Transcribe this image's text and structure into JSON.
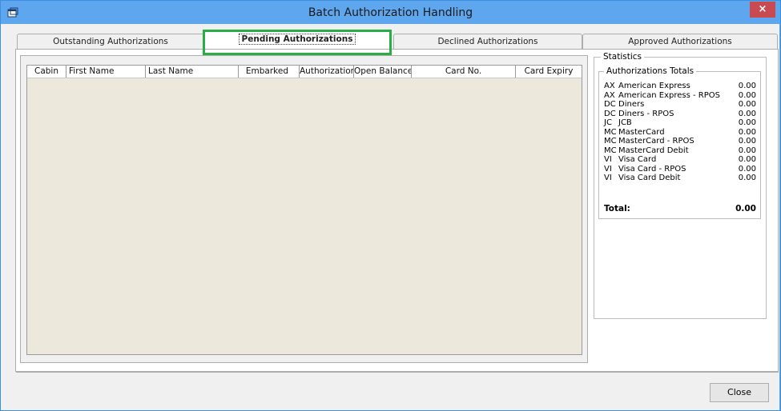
{
  "window": {
    "title": "Batch Authorization Handling",
    "close_glyph": "×"
  },
  "tabs": [
    {
      "label": "Outstanding Authorizations"
    },
    {
      "label": "Pending Authorizations"
    },
    {
      "label": "Declined Authorizations"
    },
    {
      "label": "Approved Authorizations"
    }
  ],
  "grid": {
    "columns": [
      "Cabin",
      "First Name",
      "Last Name",
      "Embarked",
      "Authorization",
      "Open Balance",
      "Card No.",
      "Card Expiry"
    ]
  },
  "stats": {
    "title": "Statistics",
    "totals_title": "Authorizations Totals",
    "rows": [
      {
        "code": "AX",
        "name": "American Express",
        "amount": "0.00"
      },
      {
        "code": "AX",
        "name": "American Express - RPOS",
        "amount": "0.00"
      },
      {
        "code": "DC",
        "name": "Diners",
        "amount": "0.00"
      },
      {
        "code": "DC",
        "name": "Diners - RPOS",
        "amount": "0.00"
      },
      {
        "code": "JC",
        "name": "JCB",
        "amount": "0.00"
      },
      {
        "code": "MC",
        "name": "MasterCard",
        "amount": "0.00"
      },
      {
        "code": "MC",
        "name": "MasterCard - RPOS",
        "amount": "0.00"
      },
      {
        "code": "MC",
        "name": "MasterCard Debit",
        "amount": "0.00"
      },
      {
        "code": "VI",
        "name": "Visa Card",
        "amount": "0.00"
      },
      {
        "code": "VI",
        "name": "Visa Card - RPOS",
        "amount": "0.00"
      },
      {
        "code": "VI",
        "name": "Visa Card Debit",
        "amount": "0.00"
      }
    ],
    "total_label": "Total:",
    "total_amount": "0.00"
  },
  "buttons": {
    "close": "Close"
  },
  "colors": {
    "titlebar": "#5ea7ef",
    "close_x": "#c74b50",
    "highlight": "#27ae46",
    "grid_bg": "#ece9dc"
  },
  "icons": {
    "app": "window-icon",
    "close": "close-icon"
  }
}
